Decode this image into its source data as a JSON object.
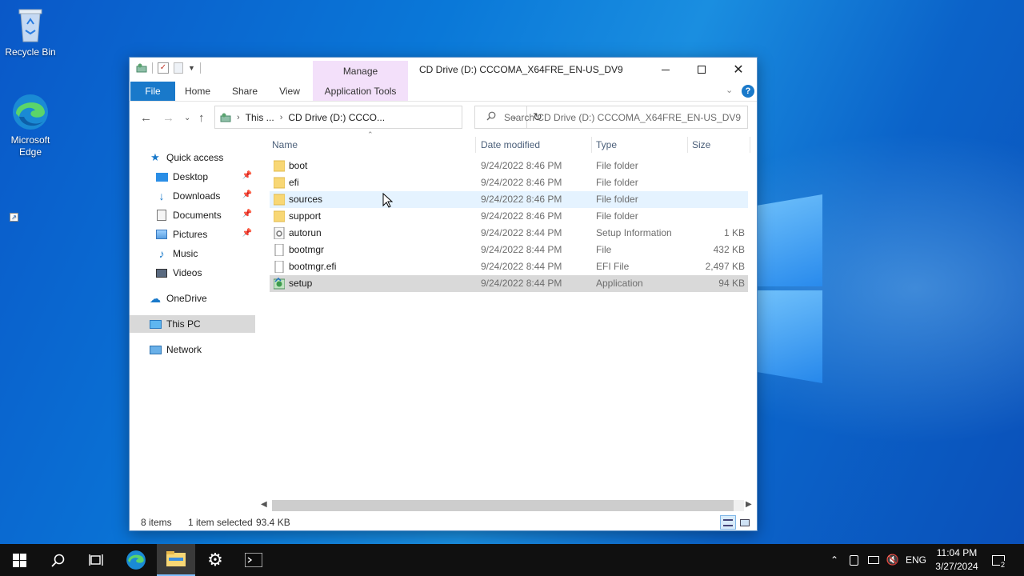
{
  "desktop": {
    "recycle_bin_label": "Recycle Bin",
    "edge_label": "Microsoft Edge"
  },
  "window": {
    "title": "CD Drive (D:) CCCOMA_X64FRE_EN-US_DV9",
    "manage_tab": "Manage",
    "ribbon_tabs": [
      "File",
      "Home",
      "Share",
      "View",
      "Application Tools"
    ],
    "help_label": "?"
  },
  "address": {
    "crumb1": "This ...",
    "crumb2": "CD Drive (D:) CCCO...",
    "search_placeholder": "Search CD Drive (D:) CCCOMA_X64FRE_EN-US_DV9"
  },
  "navpane": {
    "quick_access": "Quick access",
    "items": [
      {
        "label": "Desktop"
      },
      {
        "label": "Downloads"
      },
      {
        "label": "Documents"
      },
      {
        "label": "Pictures"
      },
      {
        "label": "Music"
      },
      {
        "label": "Videos"
      }
    ],
    "onedrive": "OneDrive",
    "this_pc": "This PC",
    "network": "Network"
  },
  "columns": {
    "name": "Name",
    "date": "Date modified",
    "type": "Type",
    "size": "Size"
  },
  "files": [
    {
      "name": "boot",
      "date": "9/24/2022 8:46 PM",
      "type": "File folder",
      "size": "",
      "icon": "folder-icon"
    },
    {
      "name": "efi",
      "date": "9/24/2022 8:46 PM",
      "type": "File folder",
      "size": "",
      "icon": "folder-icon"
    },
    {
      "name": "sources",
      "date": "9/24/2022 8:46 PM",
      "type": "File folder",
      "size": "",
      "icon": "folder-icon"
    },
    {
      "name": "support",
      "date": "9/24/2022 8:46 PM",
      "type": "File folder",
      "size": "",
      "icon": "folder-icon"
    },
    {
      "name": "autorun",
      "date": "9/24/2022 8:44 PM",
      "type": "Setup Information",
      "size": "1 KB",
      "icon": "setup-info-icon"
    },
    {
      "name": "bootmgr",
      "date": "9/24/2022 8:44 PM",
      "type": "File",
      "size": "432 KB",
      "icon": "file-icon"
    },
    {
      "name": "bootmgr.efi",
      "date": "9/24/2022 8:44 PM",
      "type": "EFI File",
      "size": "2,497 KB",
      "icon": "file-icon"
    },
    {
      "name": "setup",
      "date": "9/24/2022 8:44 PM",
      "type": "Application",
      "size": "94 KB",
      "icon": "application-icon"
    }
  ],
  "status": {
    "items": "8 items",
    "selected": "1 item selected",
    "size": "93.4 KB"
  },
  "taskbar": {
    "language": "ENG",
    "time": "11:04 PM",
    "date": "3/27/2024",
    "notification_count": "2"
  },
  "colors": {
    "accent": "#1979ca",
    "manage_tab": "#f3e0fa",
    "selection": "#d9d9d9",
    "hover": "#e5f3ff"
  }
}
